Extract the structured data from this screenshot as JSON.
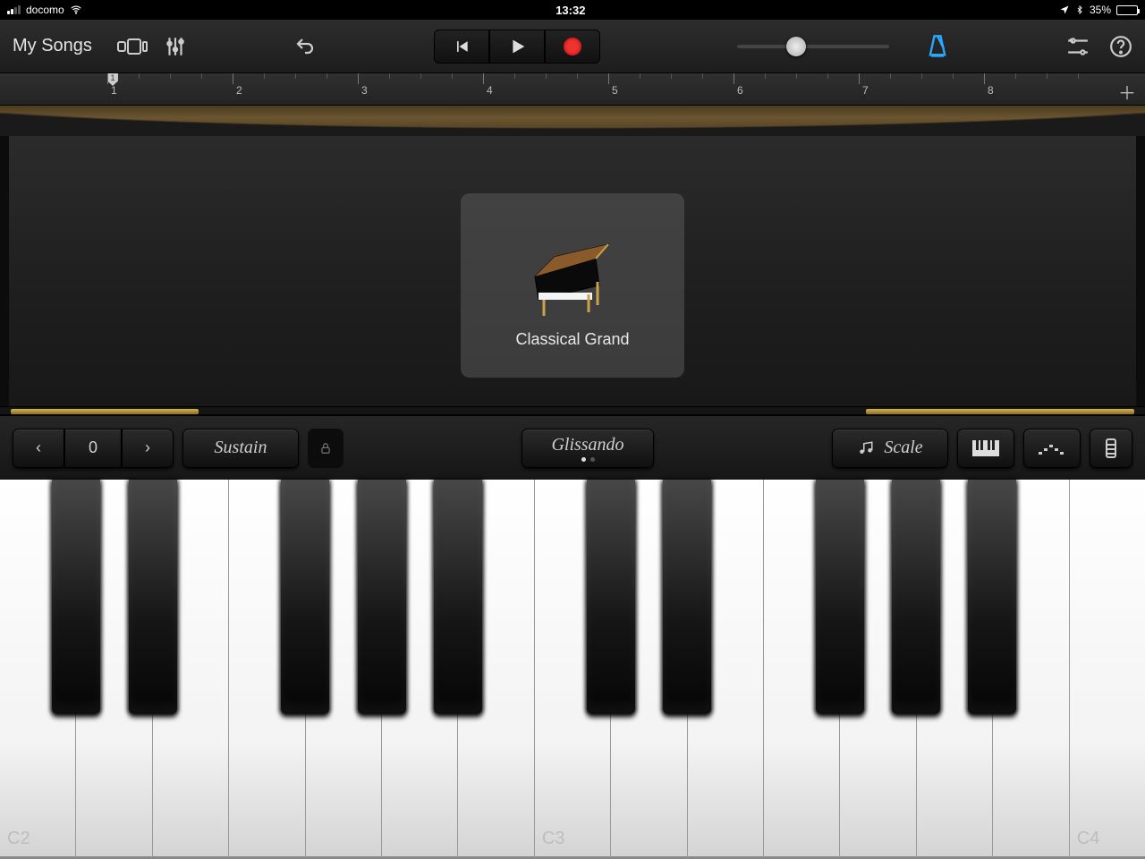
{
  "status": {
    "carrier": "docomo",
    "time": "13:32",
    "battery_pct": "35%"
  },
  "toolbar": {
    "back_label": "My Songs"
  },
  "ruler": {
    "bars": [
      "1",
      "2",
      "3",
      "4",
      "5",
      "6",
      "7",
      "8"
    ],
    "playhead": "1"
  },
  "instrument": {
    "name": "Classical Grand"
  },
  "controls": {
    "octave_value": "0",
    "sustain_label": "Sustain",
    "glissando_label": "Glissando",
    "scale_label": "Scale"
  },
  "keyboard": {
    "labels": {
      "0": "C2",
      "7": "C3",
      "14": "C4"
    },
    "white_count": 15,
    "black_positions": [
      0,
      1,
      3,
      4,
      5,
      7,
      8,
      10,
      11,
      12
    ]
  }
}
